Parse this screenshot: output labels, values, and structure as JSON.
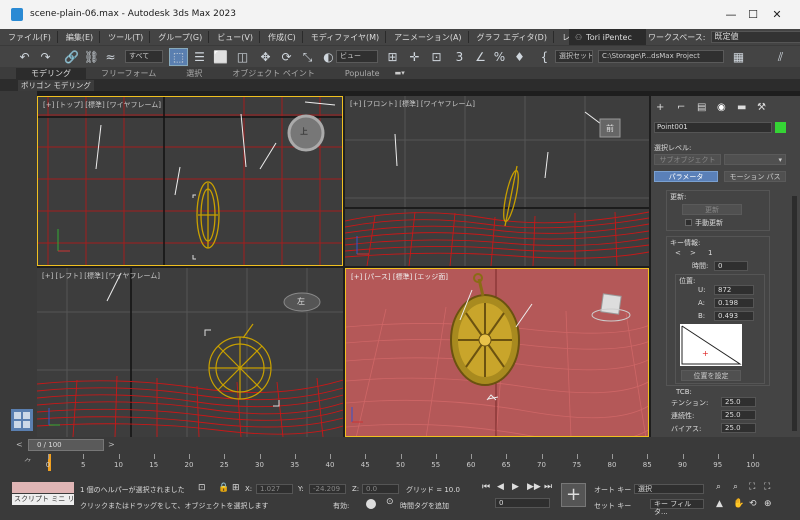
{
  "window": {
    "title": "scene-plain-06.max - Autodesk 3ds Max 2023",
    "minimize": "—",
    "maximize": "☐",
    "close": "✕"
  },
  "menu": [
    "ファイル(F)",
    "編集(E)",
    "ツール(T)",
    "グループ(G)",
    "ビュー(V)",
    "作成(C)",
    "モディファイヤ(M)",
    "アニメーション(A)",
    "グラフ エディタ(D)",
    "レンダリング(R)"
  ],
  "user": "Tori iPentec",
  "workspace": {
    "label": "ワークスペース:",
    "value": "既定値"
  },
  "toolbar": {
    "filter": "すべて",
    "refcoord": "ビュー",
    "selset": "選択セット",
    "path": "C:\\Storage\\P...dsMax Project"
  },
  "ribbon": {
    "tabs": [
      "モデリング",
      "フリーフォーム",
      "選択",
      "オブジェクト ペイント",
      "Populate"
    ],
    "sub": "ポリゴン モデリング"
  },
  "viewports": {
    "top": "[+] [トップ] [標準] [ワイヤフレーム]",
    "front": "[+] [フロント] [標準] [ワイヤフレーム]",
    "left": "[+] [レフト] [標準] [ワイヤフレーム]",
    "persp": "[+] [パース] [標準] [エッジ面]",
    "cube_top": "上",
    "cube_front": "前",
    "cube_left": "左"
  },
  "cmd": {
    "object_name": "Point001",
    "accent": "#35d435",
    "sel_level": "選択レベル:",
    "sub_object": "サブオブジェクト",
    "param_btn": "パラメータ",
    "motion_btn": "モーション パス",
    "update_hdr": "更新:",
    "update_btn": "更新",
    "manual": "手動更新",
    "keyinfo_hdr": "キー情報:",
    "key_index": "1",
    "time_label": "時間:",
    "time_val": "0",
    "pos_hdr": "位置:",
    "u_label": "U:",
    "u_val": "872",
    "a_label": "A:",
    "a_val": "0.198",
    "b_label": "B:",
    "b_val": "0.493",
    "setpos": "位置を設定",
    "tcb_hdr": "TCB:",
    "tension_label": "テンション:",
    "tension": "25.0",
    "cont_label": "連続性:",
    "cont": "25.0",
    "bias_label": "バイアス:",
    "bias": "25.0"
  },
  "time": {
    "slider": "0 / 100",
    "ticks": [
      "0",
      "5",
      "10",
      "15",
      "20",
      "25",
      "30",
      "35",
      "40",
      "45",
      "50",
      "55",
      "60",
      "65",
      "70",
      "75",
      "80",
      "85",
      "90",
      "95",
      "100"
    ]
  },
  "status": {
    "script": "スクリプト ミニ リス",
    "msg1": "1 個のヘルパーが選択されました",
    "msg2": "クリックまたはドラッグをして、オブジェクトを選択します",
    "x_label": "X:",
    "x": "1.027",
    "y_label": "Y:",
    "y": "-24.209",
    "z_label": "Z:",
    "z": "0.0",
    "grid": "グリッド = 10.0",
    "valid": "有効:",
    "addtag": "時間タグを追加",
    "frame": "0",
    "autokey": "オート キー",
    "setkey": "セット キー",
    "sel": "選択",
    "keyfilter": "キー フィルタ..."
  }
}
